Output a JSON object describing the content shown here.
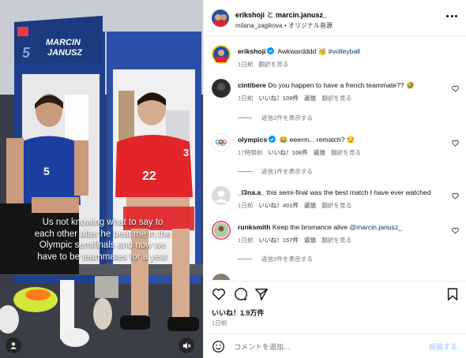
{
  "media": {
    "caption": "Us not knowing what to say to each other after he beat me in the Olympic semifinals and now we have to be teammates for a year",
    "locker_name_line1": "MARCIN",
    "locker_name_line2": "JANUSZ",
    "locker_number": "5",
    "player_left_jersey": "5",
    "player_right_jersey": "22",
    "player_right_side_number": "3",
    "icons": {
      "user": "user-icon",
      "mute": "speaker-muted-icon"
    }
  },
  "header": {
    "author": "erikshoji",
    "joiner": " と ",
    "collaborator": "marcin.janusz_",
    "subline": "milana_zagikova • オリジナル音源",
    "more_icon": "more-horizontal-icon"
  },
  "comments": [
    {
      "user": "erikshoji",
      "text": " Awkwardddd 🥳 ",
      "tag": "#volleyball",
      "time": "1日前",
      "likes": "",
      "reply": "",
      "translate": "翻訳を見る",
      "verified": true
    },
    {
      "user": "cintibere",
      "text": " Do you happen to have a french teammate?? 🤣",
      "time": "1日前",
      "likes": "いいね！109件",
      "reply": "返信",
      "translate": "翻訳を見る",
      "replies": "返信2件を表示する"
    },
    {
      "user": "olympics",
      "text": " 😂 eeerm... rematch? 😏",
      "time": "17時間前",
      "likes": "いいね！106件",
      "reply": "返信",
      "translate": "翻訳を見る",
      "replies": "返信1件を表示する",
      "verified": true
    },
    {
      "user": "_l3na.a_",
      "text": " this semi-final was the best match I have ever watched",
      "time": "1日前",
      "likes": "いいね！401件",
      "reply": "返信",
      "translate": "翻訳を見る"
    },
    {
      "user": "runksmith",
      "text": " Keep the bromance alive ",
      "mention": "@marcin.janusz_",
      "time": "1日前",
      "likes": "いいね！157件",
      "reply": "返信",
      "translate": "翻訳を見る",
      "replies": "返信2件を表示する"
    }
  ],
  "actions": {
    "likes": "いいね！1.9万件",
    "date": "1日前",
    "icons": [
      "heart-icon",
      "comment-icon",
      "share-icon",
      "bookmark-icon"
    ]
  },
  "comment_bar": {
    "placeholder": "コメントを追加...",
    "post_label": "投稿する"
  },
  "colors": {
    "accent": "#0095f6",
    "verified": "#0095f6",
    "link": "#00376b",
    "muted": "#737373"
  }
}
